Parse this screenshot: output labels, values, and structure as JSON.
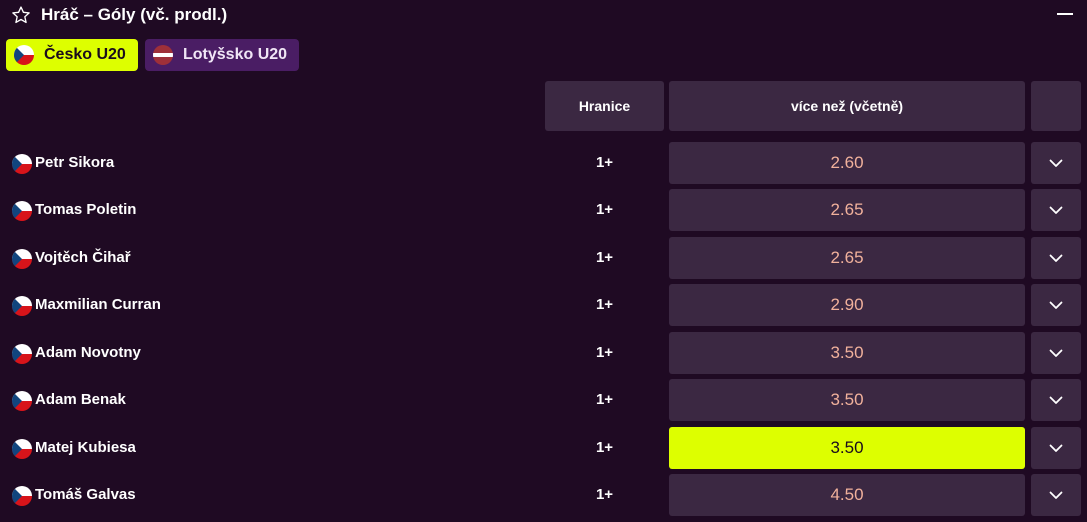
{
  "header": {
    "title": "Hráč – Góly (vč. prodl.)"
  },
  "teams": [
    {
      "label": "Česko U20",
      "active": true,
      "flag": "czech-flag"
    },
    {
      "label": "Lotyšsko U20",
      "active": false,
      "flag": "latvia-flag"
    }
  ],
  "table": {
    "col_line": "Hranice",
    "col_over": "více než (včetně)",
    "rows": [
      {
        "player": "Petr Sikora",
        "line": "1+",
        "odds": "2.60",
        "selected": false
      },
      {
        "player": "Tomas Poletin",
        "line": "1+",
        "odds": "2.65",
        "selected": false
      },
      {
        "player": "Vojtěch Čihař",
        "line": "1+",
        "odds": "2.65",
        "selected": false
      },
      {
        "player": "Maxmilian Curran",
        "line": "1+",
        "odds": "2.90",
        "selected": false
      },
      {
        "player": "Adam Novotny",
        "line": "1+",
        "odds": "3.50",
        "selected": false
      },
      {
        "player": "Adam Benak",
        "line": "1+",
        "odds": "3.50",
        "selected": false
      },
      {
        "player": "Matej Kubiesa",
        "line": "1+",
        "odds": "3.50",
        "selected": true
      },
      {
        "player": "Tomáš Galvas",
        "line": "1+",
        "odds": "4.50",
        "selected": false
      }
    ]
  },
  "colors": {
    "background": "#1f0a23",
    "cell": "#3b2842",
    "accent": "#ddff00",
    "odds_text": "#f1b19c",
    "team_inactive": "#4a1d64"
  },
  "icons": {
    "favorite": "star-outline-icon",
    "collapse": "minus-icon",
    "expand": "chevron-down-icon"
  }
}
